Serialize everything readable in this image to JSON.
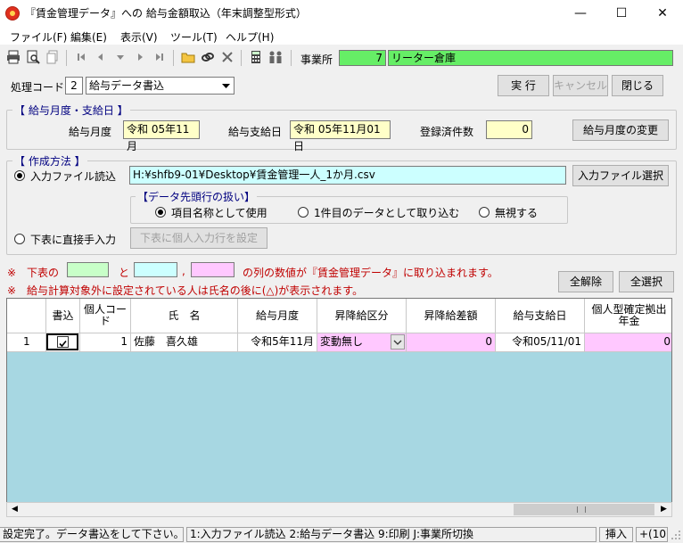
{
  "window": {
    "title": "『賃金管理データ』への 給与金額取込（年末調整型形式）",
    "minimize": "—",
    "maximize": "☐",
    "close": "✕"
  },
  "menu": [
    "ファイル(F)",
    "編集(E)",
    "表示(V)",
    "ツール(T)",
    "ヘルプ(H)"
  ],
  "toolbar": {
    "office_label": "事業所",
    "office_code": "7",
    "office_name": "リーター倉庫"
  },
  "process": {
    "label": "処理コード",
    "code": "2",
    "selected": "給与データ書込",
    "run": "実 行",
    "cancel": "キャンセル",
    "close": "閉じる"
  },
  "month_group": {
    "title": "【 給与月度・支給日 】",
    "month_label": "給与月度",
    "month_value": "令和 05年11月",
    "pay_label": "給与支給日",
    "pay_value": "令和 05年11月01日",
    "count_label": "登録済件数",
    "count_value": "0",
    "change_button": "給与月度の変更"
  },
  "method_group": {
    "title": "【 作成方法 】",
    "file_read_label": "入力ファイル読込",
    "file_path": "H:¥shfb9-01¥Desktop¥賃金管理一人_1か月.csv",
    "file_select_button": "入力ファイル選択",
    "header_group_title": "【データ先頭行の扱い】",
    "opt1": "項目名称として使用",
    "opt2": "1件目のデータとして取り込む",
    "opt3": "無視する",
    "direct_label": "下表に直接手入力",
    "direct_button": "下表に個人入力行を設定"
  },
  "notes": {
    "line1_a": "※　下表の",
    "line1_b": "と",
    "line1_c": ",",
    "line1_d": "の列の数値が『賃金管理データ』に取り込まれます。",
    "line2": "※　給与計算対象外に設定されている人は氏名の後に(△)が表示されます。",
    "clear_all": "全解除",
    "select_all": "全選択"
  },
  "table": {
    "headers": [
      "書込",
      "個人コード",
      "氏　名",
      "給与月度",
      "昇降給区分",
      "昇降給差額",
      "給与支給日",
      "個人型確定拠出年金"
    ],
    "row": {
      "no": "1",
      "write": true,
      "code": "1",
      "name": "佐藤　喜久雄",
      "month": "令和5年11月",
      "raise_class": "変動無し",
      "raise_diff": "0",
      "pay_date": "令和05/11/01",
      "pension": "0"
    }
  },
  "statusbar": {
    "message": "設定完了。データ書込をして下さい。",
    "keys": "1:入力ファイル読込  2:給与データ書込  9:印刷  J:事業所切換",
    "mode": "挿入",
    "extra": "+(10)"
  },
  "colors": {
    "office_green": "#66ee66",
    "grid_bg": "#a7d7e2",
    "note_red": "#c00000"
  }
}
